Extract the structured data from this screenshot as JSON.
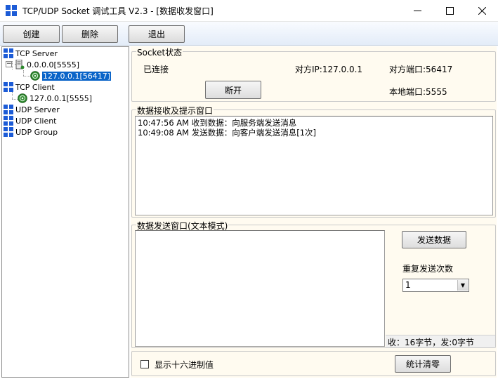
{
  "window": {
    "title": "TCP/UDP Socket 调试工具 V2.3 - [数据收发窗口]",
    "controls": {
      "minimize": "—",
      "maximize": "☐",
      "close": "✕"
    }
  },
  "toolbar": {
    "create_label": "创建",
    "delete_label": "删除",
    "exit_label": "退出"
  },
  "tree": {
    "tcp_server": "TCP Server",
    "server_node": "0.0.0.0[5555]",
    "server_conn": "127.0.0.1[56417]",
    "tcp_client": "TCP Client",
    "client_node": "127.0.0.1[5555]",
    "udp_server": "UDP Server",
    "udp_client": "UDP Client",
    "udp_group": "UDP Group"
  },
  "socket_status": {
    "group_title": "Socket状态",
    "state": "已连接",
    "peer_ip": "对方IP:127.0.0.1",
    "peer_port": "对方端口:56417",
    "local_port": "本地端口:5555",
    "disconnect_label": "断开"
  },
  "receive": {
    "group_title": "数据接收及提示窗口",
    "lines": [
      "10:47:56 AM 收到数据：向服务端发送消息",
      "10:49:08 AM 发送数据：向客户端发送消息[1次]"
    ]
  },
  "send": {
    "group_title": "数据发送窗口(文本模式)",
    "content": "",
    "send_label": "发送数据",
    "repeat_label": "重复发送次数",
    "repeat_value": "1",
    "stats": "收：16字节，发:0字节"
  },
  "bottom": {
    "hex_label": "显示十六进制值",
    "hex_checked": false,
    "clear_stats_label": "统计清零"
  },
  "colors": {
    "selection": "#0a64c8",
    "panel_bg": "#fffbf0",
    "icon_blue": "#1c5bd6",
    "status_green": "#2d8a2d"
  }
}
